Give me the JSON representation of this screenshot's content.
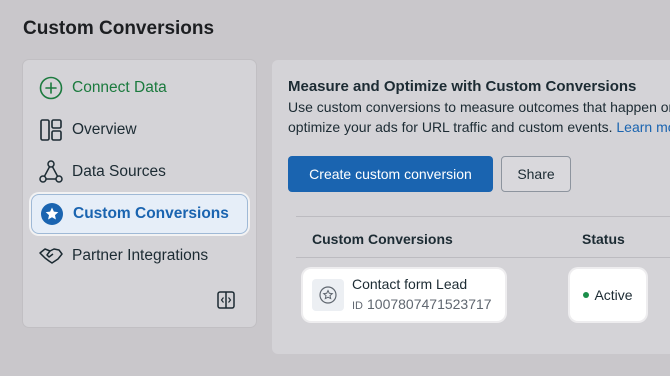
{
  "page": {
    "title": "Custom Conversions"
  },
  "sidebar": {
    "items": [
      {
        "label": "Connect Data",
        "icon": "plus-circle-icon"
      },
      {
        "label": "Overview",
        "icon": "overview-icon"
      },
      {
        "label": "Data Sources",
        "icon": "data-sources-icon"
      },
      {
        "label": "Custom Conversions",
        "icon": "star-badge-icon",
        "active": true
      },
      {
        "label": "Partner Integrations",
        "icon": "handshake-icon"
      }
    ],
    "collapse_icon": "panel-collapse-icon"
  },
  "main": {
    "heading": "Measure and Optimize with Custom Conversions",
    "desc_line1": "Use custom conversions to measure outcomes that happen on",
    "desc_line2": "optimize your ads for URL traffic and custom events.",
    "learn_more": "Learn more",
    "create_button": "Create custom conversion",
    "share_button": "Share"
  },
  "table": {
    "headers": {
      "name": "Custom Conversions",
      "status": "Status"
    },
    "rows": [
      {
        "name": "Contact form Lead",
        "id_label": "ID",
        "id": "1007807471523717",
        "status": "Active"
      }
    ]
  },
  "colors": {
    "accent": "#1a64b0",
    "connect_green": "#1b7a3e",
    "status_active": "#1b8e4a"
  }
}
